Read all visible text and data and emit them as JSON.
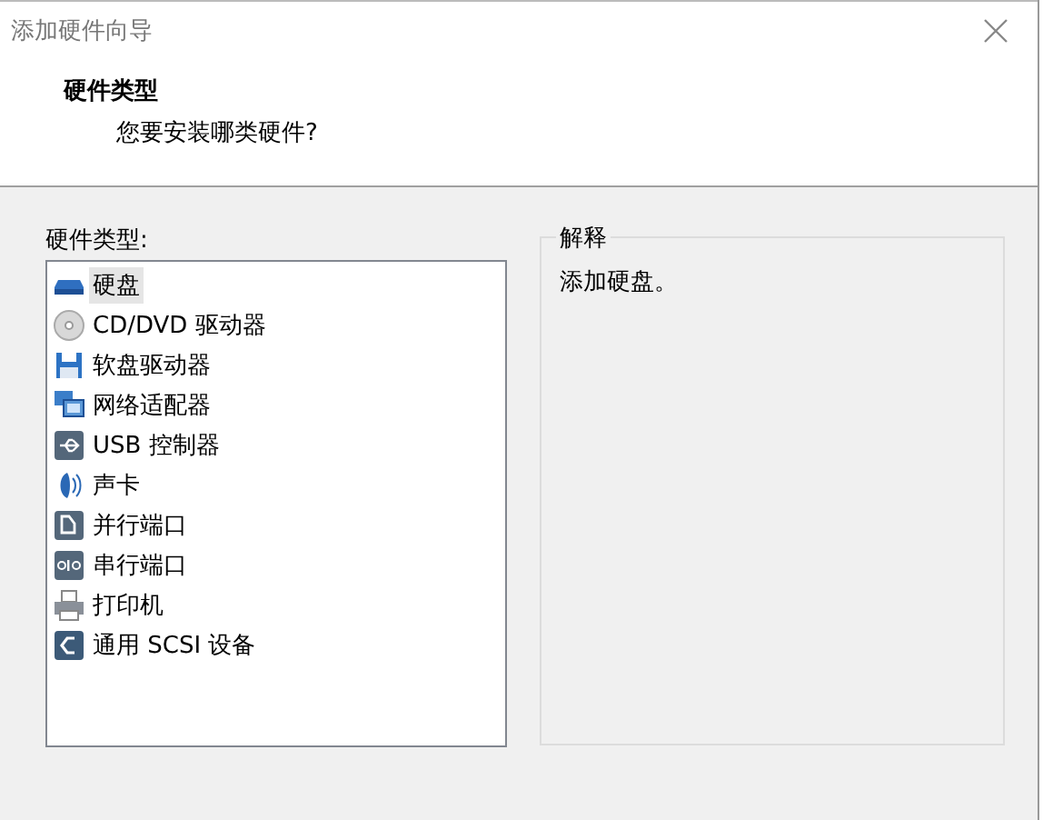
{
  "window": {
    "title": "添加硬件向导"
  },
  "header": {
    "title": "硬件类型",
    "subtitle": "您要安装哪类硬件?"
  },
  "hardware_list": {
    "label": "硬件类型:",
    "items": [
      {
        "kind": "disk",
        "label": "硬盘",
        "selected": true
      },
      {
        "kind": "cd",
        "label": "CD/DVD 驱动器",
        "selected": false
      },
      {
        "kind": "floppy",
        "label": "软盘驱动器",
        "selected": false
      },
      {
        "kind": "network",
        "label": "网络适配器",
        "selected": false
      },
      {
        "kind": "usb",
        "label": "USB 控制器",
        "selected": false
      },
      {
        "kind": "sound",
        "label": "声卡",
        "selected": false
      },
      {
        "kind": "parallel",
        "label": "并行端口",
        "selected": false
      },
      {
        "kind": "serial",
        "label": "串行端口",
        "selected": false
      },
      {
        "kind": "printer",
        "label": "打印机",
        "selected": false
      },
      {
        "kind": "scsi",
        "label": "通用 SCSI 设备",
        "selected": false
      }
    ]
  },
  "explanation": {
    "label": "解释",
    "text": "添加硬盘。"
  }
}
